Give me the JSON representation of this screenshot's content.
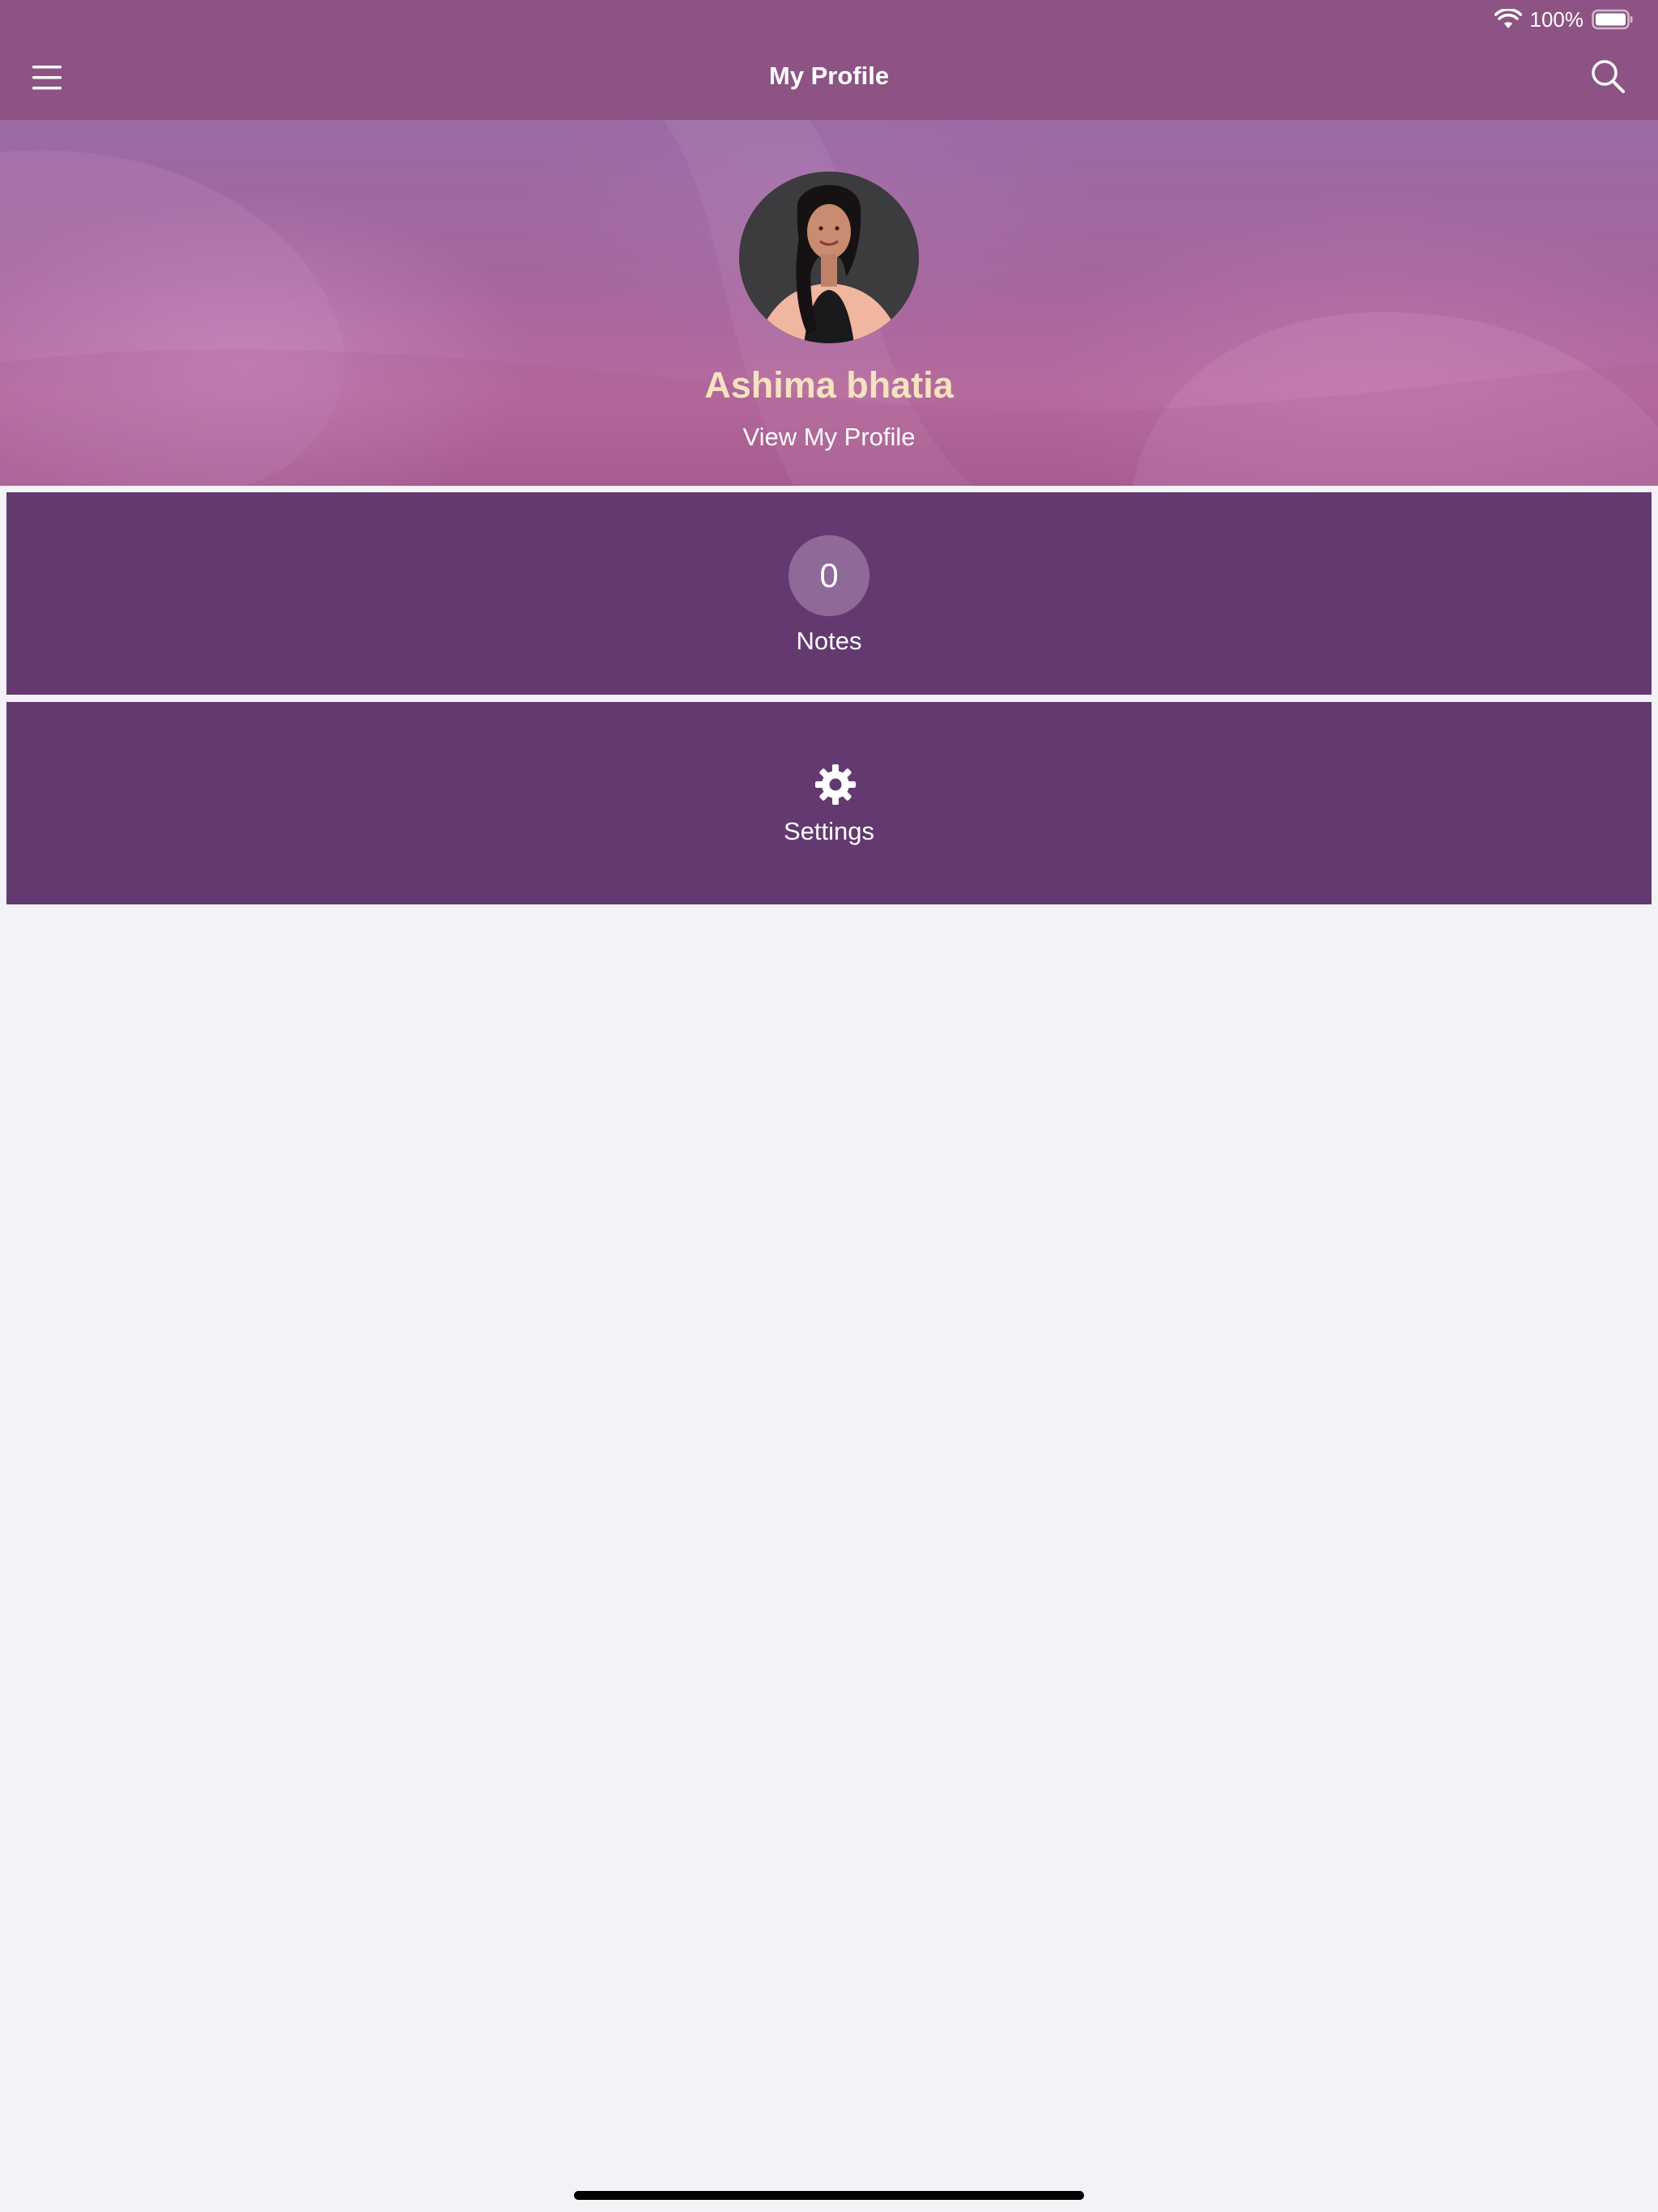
{
  "status_bar": {
    "battery_percent": "100%",
    "icons": [
      "wifi-icon",
      "battery-icon"
    ]
  },
  "nav": {
    "title": "My Profile",
    "left_icon": "hamburger-menu-icon",
    "right_icon": "search-icon"
  },
  "profile": {
    "name": "Ashima bhatia",
    "view_link": "View My Profile"
  },
  "tiles": {
    "notes": {
      "count": "0",
      "label": "Notes"
    },
    "settings": {
      "icon": "gear-icon",
      "label": "Settings"
    }
  },
  "colors": {
    "nav_background": "#8c5384",
    "tile_background": "#633970",
    "count_circle": "#8f6a98",
    "name_text": "#f7e2c0",
    "page_background": "#f2f2f7"
  }
}
